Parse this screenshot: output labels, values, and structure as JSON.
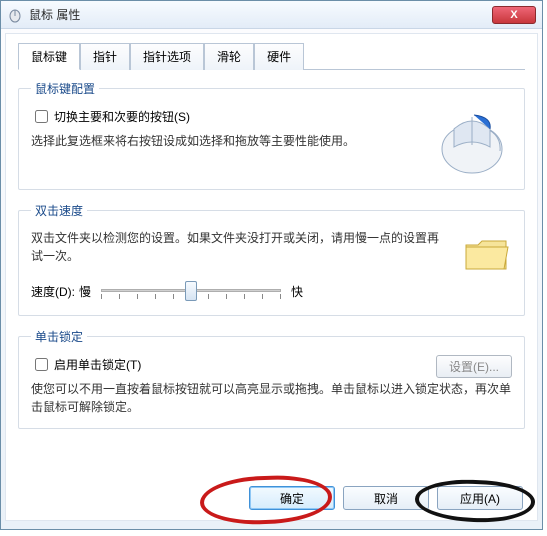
{
  "window": {
    "title": "鼠标 属性",
    "close_glyph": "X"
  },
  "tabs": [
    {
      "label": "鼠标键",
      "active": true
    },
    {
      "label": "指针",
      "active": false
    },
    {
      "label": "指针选项",
      "active": false
    },
    {
      "label": "滑轮",
      "active": false
    },
    {
      "label": "硬件",
      "active": false
    }
  ],
  "group_buttons": {
    "legend": "鼠标键配置",
    "checkbox_label": "切换主要和次要的按钮(S)",
    "checkbox_checked": false,
    "desc": "选择此复选框来将右按钮设成如选择和拖放等主要性能使用。"
  },
  "group_doubleclick": {
    "legend": "双击速度",
    "desc": "双击文件夹以检测您的设置。如果文件夹没打开或关闭，请用慢一点的设置再试一次。",
    "speed_label": "速度(D):",
    "slow": "慢",
    "fast": "快",
    "slider_ticks": 11,
    "slider_position_percent": 50
  },
  "group_clicklock": {
    "legend": "单击锁定",
    "checkbox_label": "启用单击锁定(T)",
    "checkbox_checked": false,
    "settings_btn": "设置(E)...",
    "settings_enabled": false,
    "desc": "使您可以不用一直按着鼠标按钮就可以高亮显示或拖拽。单击鼠标以进入锁定状态，再次单击鼠标可解除锁定。"
  },
  "buttons": {
    "ok": "确定",
    "cancel": "取消",
    "apply": "应用(A)"
  },
  "annotations": {
    "red_circle_target": "ok-button",
    "black_circle_target": "apply-button"
  }
}
